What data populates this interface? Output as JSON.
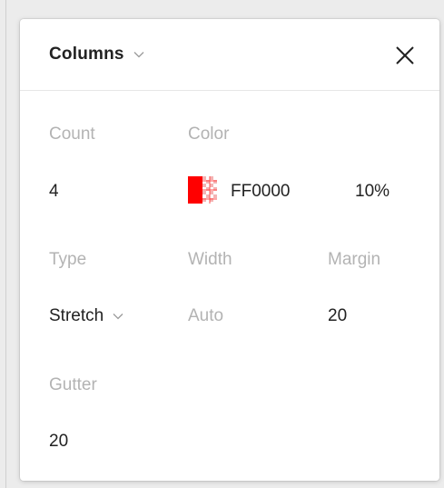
{
  "panel": {
    "title": "Columns",
    "close_icon": "close-icon",
    "title_dropdown_icon": "chevron-down-icon"
  },
  "fields": {
    "count_label": "Count",
    "count_value": "4",
    "color_label": "Color",
    "color_hex": "FF0000",
    "color_opacity": "10%",
    "color_swatch": "#FF0000",
    "type_label": "Type",
    "type_value": "Stretch",
    "width_label": "Width",
    "width_value": "Auto",
    "margin_label": "Margin",
    "margin_value": "20",
    "gutter_label": "Gutter",
    "gutter_value": "20"
  }
}
